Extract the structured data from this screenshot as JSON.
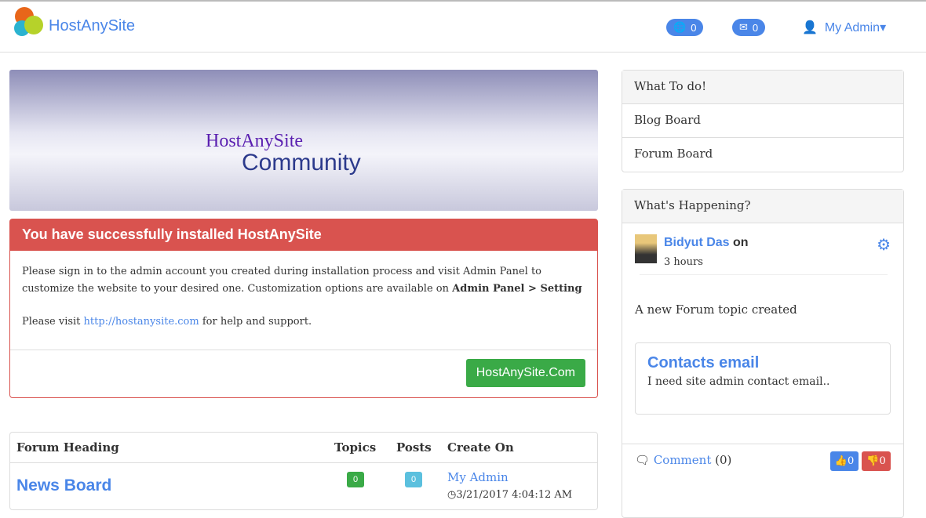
{
  "header": {
    "brand": "HostAnySite",
    "globe_count": "0",
    "mail_count": "0",
    "user_menu": "My Admin"
  },
  "banner": {
    "line1": "HostAnySite",
    "line2": "Community"
  },
  "alert": {
    "title": "You have successfully installed HostAnySite",
    "body1": "Please sign in to the admin account you created during installation process and visit Admin Panel to customize the website to your desired one. Customization options are available on ",
    "body1_bold": "Admin Panel > Setting",
    "body2_pre": "Please visit ",
    "link": "http://hostanysite.com",
    "body2_post": " for help and support.",
    "button": "HostAnySite.Com"
  },
  "forum": {
    "headers": [
      "Forum Heading",
      "Topics",
      "Posts",
      "Create On"
    ],
    "rows": [
      {
        "name": "News Board",
        "topics": "0",
        "posts": "0",
        "creator": "My Admin",
        "date": "3/21/2017 4:04:12 AM"
      }
    ]
  },
  "todo": {
    "title": "What To do!",
    "items": [
      "Blog Board",
      "Forum Board"
    ]
  },
  "happening": {
    "title": "What's Happening?",
    "user": "Bidyut Das",
    "on": "on",
    "time": "3 hours",
    "text": "A new Forum topic created",
    "card_title": "Contacts email",
    "card_text": "I need site admin contact email..",
    "comment": "Comment",
    "comment_count": "(0)",
    "likes": "0",
    "dislikes": "0"
  }
}
